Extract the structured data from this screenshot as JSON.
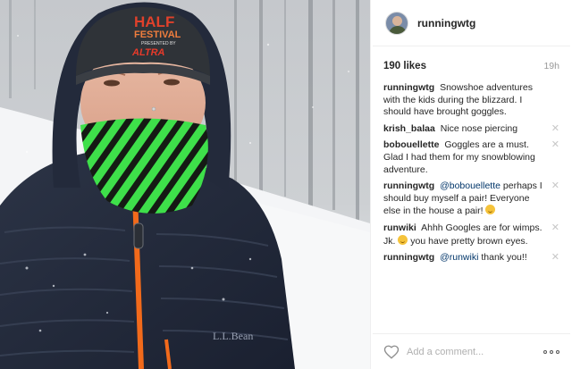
{
  "post": {
    "username": "runningwtg",
    "likes": "190 likes",
    "time": "19h",
    "photo_hat_text": {
      "brand_line1": "HALF",
      "brand_line2": "FESTIVAL",
      "brand_line3": "PRESENTED BY",
      "sponsor": "ALTRA",
      "jacket_logo": "L.L.Bean"
    }
  },
  "comments": [
    {
      "author": "runningwtg",
      "text": "Snowshoe adventures with the kids during the blizzard. I should have brought goggles.",
      "removable": false
    },
    {
      "author": "krish_balaa",
      "text": "Nice nose piercing",
      "removable": true
    },
    {
      "author": "bobouellette",
      "text": "Goggles are a must. Glad I had them for my snowblowing adventure.",
      "removable": true
    },
    {
      "author": "runningwtg",
      "mention": "@bobouellette",
      "text": "perhaps I should buy myself a pair! Everyone else in the house a pair!",
      "emoji": "smile",
      "removable": true
    },
    {
      "author": "runwiki",
      "text_before": "Ahhh Googles are for wimps. Jk.",
      "emoji": "smile",
      "text_after": "you have pretty brown eyes.",
      "removable": true
    },
    {
      "author": "runningwtg",
      "mention": "@runwiki",
      "text": "thank you!!",
      "removable": true
    }
  ],
  "footer": {
    "comment_placeholder": "Add a comment...",
    "like_icon": "heart-icon",
    "more_icon": "more-options-icon"
  },
  "colors": {
    "mention": "#003569",
    "muted": "#999999",
    "jacket": "#262d3e",
    "zipper": "#f26a1b",
    "gaiter_green": "#3ee04a"
  }
}
